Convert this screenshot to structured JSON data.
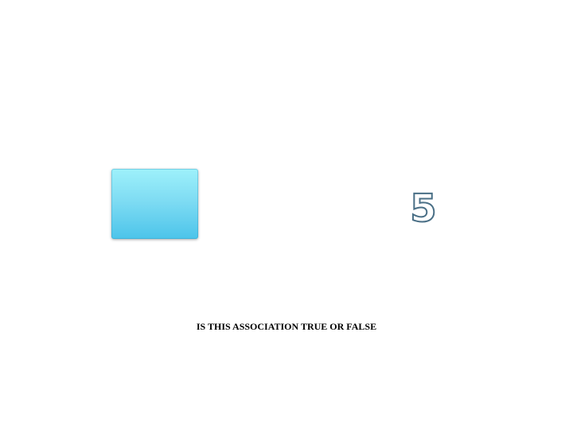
{
  "slide": {
    "shape": {
      "icon": "blue-rectangle",
      "fill_top": "#9ef1fb",
      "fill_bottom": "#4cc4ea"
    },
    "number": "5",
    "number_color": "#ffffff",
    "number_outline": "#4a6f86",
    "question": "IS THIS ASSOCIATION TRUE OR FALSE"
  }
}
